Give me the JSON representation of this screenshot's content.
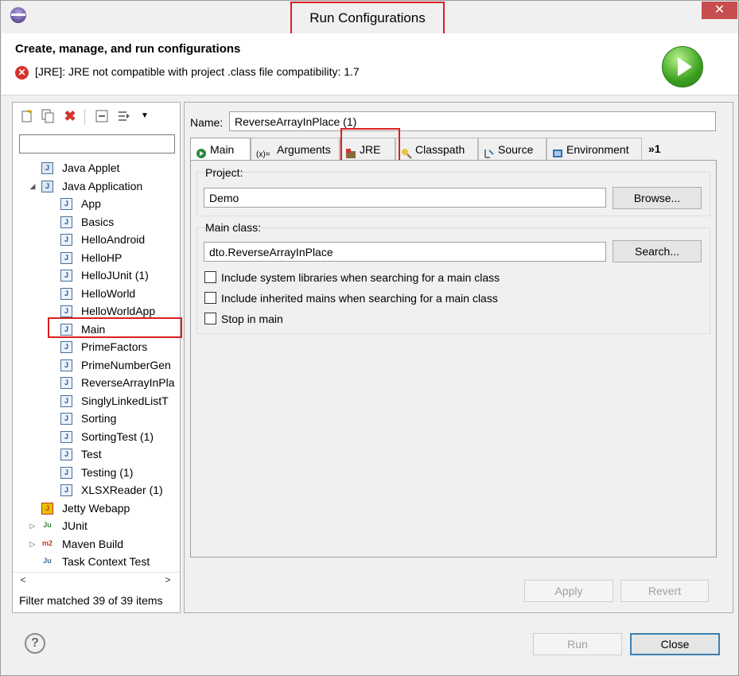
{
  "window": {
    "title": "Run Configurations",
    "close_glyph": "✕"
  },
  "header": {
    "title": "Create, manage, and run configurations",
    "error_message": "[JRE]: JRE not compatible with project .class file compatibility: 1.7",
    "error_icon": "error-icon",
    "banner_icon": "run-icon"
  },
  "left": {
    "toolbar": [
      "new-config-icon",
      "duplicate-icon",
      "delete-icon",
      "collapse-all-icon",
      "filter-icon",
      "view-menu-icon"
    ],
    "filter_value": "",
    "tree": [
      {
        "label": "Java Applet",
        "level": 1,
        "icon": "applet-icon",
        "expander": ""
      },
      {
        "label": "Java Application",
        "level": 1,
        "icon": "java-app-icon",
        "expander": "◢"
      },
      {
        "label": "App",
        "level": 2,
        "icon": "j-icon"
      },
      {
        "label": "Basics",
        "level": 2,
        "icon": "j-icon"
      },
      {
        "label": "HelloAndroid",
        "level": 2,
        "icon": "j-icon"
      },
      {
        "label": "HelloHP",
        "level": 2,
        "icon": "j-icon"
      },
      {
        "label": "HelloJUnit (1)",
        "level": 2,
        "icon": "j-icon"
      },
      {
        "label": "HelloWorld",
        "level": 2,
        "icon": "j-icon"
      },
      {
        "label": "HelloWorldApp",
        "level": 2,
        "icon": "j-icon"
      },
      {
        "label": "Main",
        "level": 2,
        "icon": "j-icon"
      },
      {
        "label": "PrimeFactors",
        "level": 2,
        "icon": "j-icon"
      },
      {
        "label": "PrimeNumberGen",
        "level": 2,
        "icon": "j-icon"
      },
      {
        "label": "ReverseArrayInPla",
        "level": 2,
        "icon": "j-icon",
        "selected": true
      },
      {
        "label": "SinglyLinkedListT",
        "level": 2,
        "icon": "j-icon"
      },
      {
        "label": "Sorting",
        "level": 2,
        "icon": "j-icon"
      },
      {
        "label": "SortingTest (1)",
        "level": 2,
        "icon": "j-icon"
      },
      {
        "label": "Test",
        "level": 2,
        "icon": "j-icon"
      },
      {
        "label": "Testing (1)",
        "level": 2,
        "icon": "j-icon"
      },
      {
        "label": "XLSXReader (1)",
        "level": 2,
        "icon": "j-icon"
      },
      {
        "label": "Jetty Webapp",
        "level": 1,
        "icon": "jetty-icon",
        "expander": ""
      },
      {
        "label": "JUnit",
        "level": 1,
        "icon": "junit-icon",
        "expander": "▷"
      },
      {
        "label": "Maven Build",
        "level": 1,
        "icon": "maven-icon",
        "expander": "▷"
      },
      {
        "label": "Task Context Test",
        "level": 1,
        "icon": "task-context-icon",
        "expander": ""
      }
    ],
    "scroll_left": "<",
    "scroll_right": ">",
    "filter_status": "Filter matched 39 of 39 items"
  },
  "right": {
    "name_label": "Name:",
    "name_value": "ReverseArrayInPlace (1)",
    "tabs": [
      {
        "label": "Main",
        "icon": "main-tab-icon",
        "active": true
      },
      {
        "label": "Arguments",
        "icon": "arguments-tab-icon"
      },
      {
        "label": "JRE",
        "icon": "jre-tab-icon"
      },
      {
        "label": "Classpath",
        "icon": "classpath-tab-icon"
      },
      {
        "label": "Source",
        "icon": "source-tab-icon"
      },
      {
        "label": "Environment",
        "icon": "environment-tab-icon"
      },
      {
        "label": "»1",
        "icon": ""
      }
    ],
    "project": {
      "label": "Project:",
      "value": "Demo",
      "browse_label": "Browse..."
    },
    "main_class": {
      "label": "Main class:",
      "value": "dto.ReverseArrayInPlace",
      "search_label": "Search..."
    },
    "checkboxes": [
      {
        "label": "Include system libraries when searching for a main class",
        "checked": false
      },
      {
        "label": "Include inherited mains when searching for a main class",
        "checked": false
      },
      {
        "label": "Stop in main",
        "checked": false
      }
    ],
    "apply_label": "Apply",
    "revert_label": "Revert"
  },
  "footer": {
    "help_glyph": "?",
    "run_label": "Run",
    "close_label": "Close"
  },
  "colors": {
    "highlight_red": "#d9201f",
    "error_red": "#d3332e",
    "run_green": "#3aa020"
  }
}
